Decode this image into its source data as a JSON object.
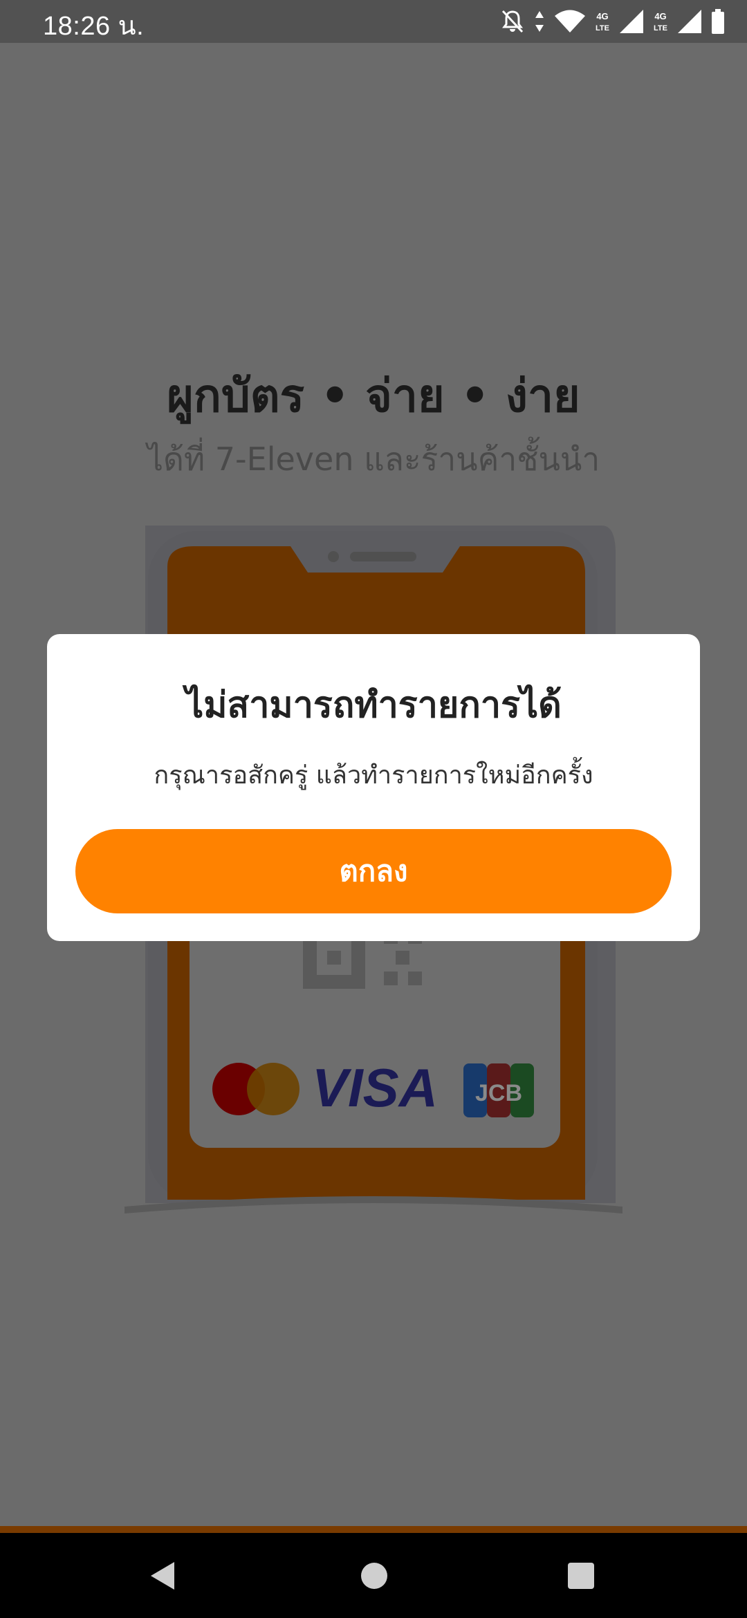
{
  "status_bar": {
    "time": "18:26 น.",
    "icons": [
      "notifications-off-icon",
      "data-arrows-icon",
      "wifi-icon",
      "4g-lte-icon",
      "signal-icon",
      "4g-lte-icon",
      "signal-icon",
      "battery-icon"
    ]
  },
  "background": {
    "headline": "ผูกบัตร • จ่าย • ง่าย",
    "subline": "ได้ที่ 7-Eleven และร้านค้าชั้นนำ",
    "card_brands": [
      "mastercard-logo",
      "VISA",
      "JCB"
    ]
  },
  "dialog": {
    "title": "ไม่สามารถทำรายการได้",
    "message": "กรุณารอสักครู่ แล้วทำรายการใหม่อีกครั้ง",
    "ok_label": "ตกลง"
  },
  "colors": {
    "accent": "#ff8200",
    "phone_orange": "#6b3500",
    "overlay_gray": "#6b6b6b"
  },
  "nav_bar": {
    "buttons": [
      "back-icon",
      "home-icon",
      "recents-icon"
    ]
  }
}
